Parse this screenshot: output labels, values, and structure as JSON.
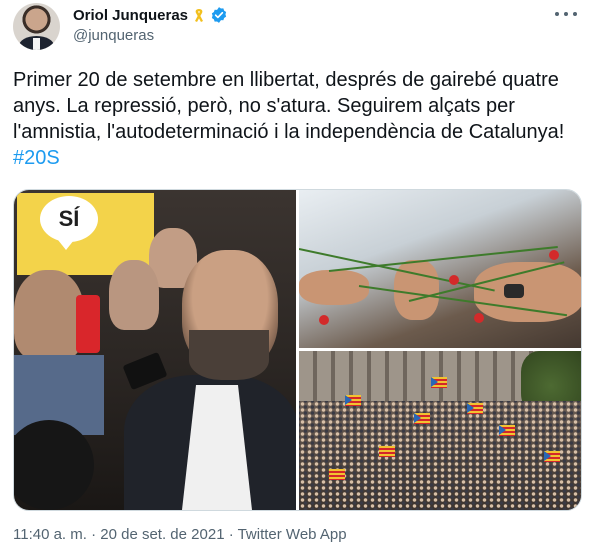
{
  "author": {
    "display_name": "Oriol Junqueras",
    "handle": "@junqueras",
    "ribbon_icon": "yellow-ribbon-icon",
    "verified_icon": "verified-badge-icon",
    "verified_color": "#1d9bf0"
  },
  "tweet": {
    "text": "Primer 20 de setembre en llibertat, després de gairebé quatre anys. La repressió, però, no s'atura. Seguirem alçats per l'amnistia, l'autodeterminació i la independència de Catalunya! ",
    "hashtag": "#20S",
    "hashtag_color": "#1d9bf0"
  },
  "media": {
    "photos": [
      {
        "label": "photo-speaking",
        "banner_text": "SÍ"
      },
      {
        "label": "photo-carnations"
      },
      {
        "label": "photo-crowd-flags"
      }
    ]
  },
  "meta": {
    "timestamp": "11:40 a. m. · 20 de set. de 2021 · Twitter Web App"
  },
  "colors": {
    "text": "#0f1419",
    "secondary": "#536471",
    "border": "#cfd9de"
  }
}
